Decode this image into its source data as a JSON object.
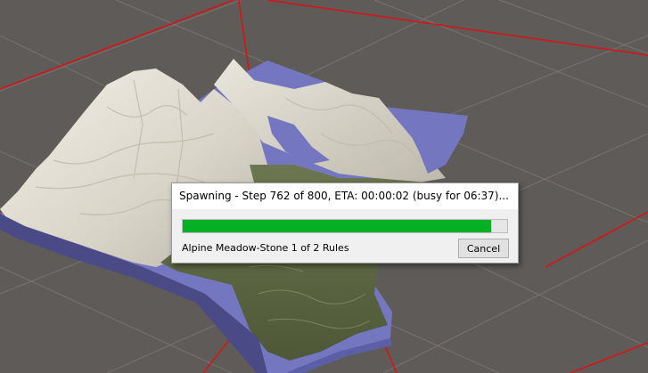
{
  "dialog": {
    "title": "Spawning - Step 762 of 800, ETA: 00:00:02 (busy for 06:37)...",
    "progress": 0.95,
    "status": "Alpine Meadow-Stone 1 of 2 Rules",
    "cancel_label": "Cancel"
  },
  "colors": {
    "viewport_background": "#5f5b59",
    "grid_line": "#8a8583",
    "axis_line": "#e01010",
    "progress_fill": "#06b025",
    "water": "#7477c0",
    "snow": "#e4e1d6",
    "forest": "#5f6a43"
  }
}
